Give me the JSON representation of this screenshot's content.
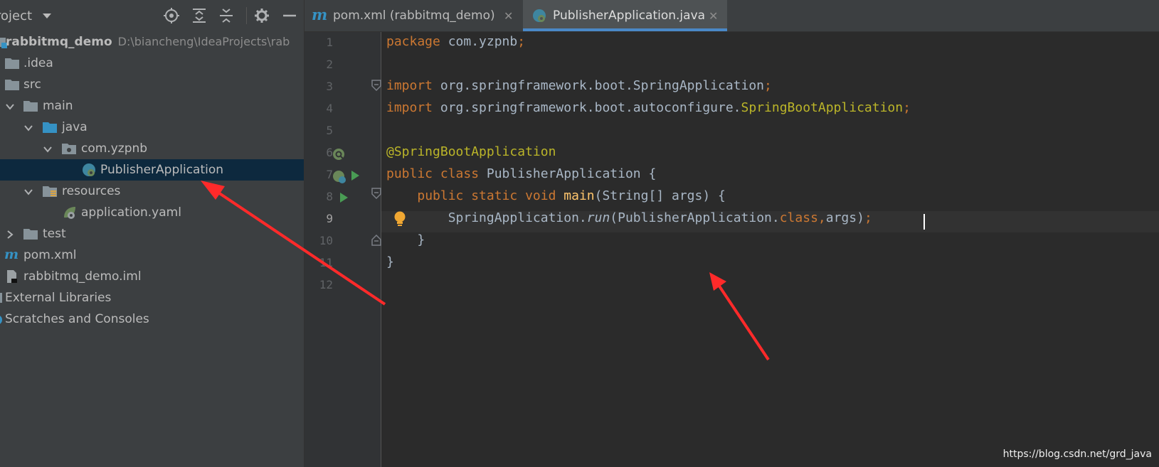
{
  "project_panel": {
    "title": "roject",
    "tree": [
      {
        "label": "rabbitmq_demo",
        "path": "D:\\biancheng\\IdeaProjects\\rab"
      },
      {
        "label": ".idea"
      },
      {
        "label": "src"
      },
      {
        "label": "main"
      },
      {
        "label": "java"
      },
      {
        "label": "com.yzpnb"
      },
      {
        "label": "PublisherApplication"
      },
      {
        "label": "resources"
      },
      {
        "label": "application.yaml"
      },
      {
        "label": "test"
      },
      {
        "label": "pom.xml"
      },
      {
        "label": "rabbitmq_demo.iml"
      },
      {
        "label": "External Libraries"
      },
      {
        "label": "Scratches and Consoles"
      }
    ],
    "icons": {
      "header": [
        "locate-icon",
        "expand-all-icon",
        "collapse-all-icon",
        "gear-icon",
        "minimize-icon"
      ],
      "tree": [
        "module-folder-icon",
        "folder-icon",
        "spring-boot-class-icon",
        "maven-icon",
        "spring-config-icon",
        "resources-folder-icon"
      ]
    }
  },
  "editor": {
    "tabs": [
      {
        "label": "pom.xml (rabbitmq_demo)",
        "close": "✕"
      },
      {
        "label": "PublisherApplication.java",
        "close": "✕"
      }
    ],
    "line_numbers": [
      "1",
      "2",
      "3",
      "4",
      "5",
      "6",
      "7",
      "8",
      "9",
      "10",
      "11",
      "12"
    ],
    "code": {
      "l1_kw": "package",
      "l1_rest": " com.yzpnb",
      "l1_semi": ";",
      "l3_kw": "import",
      "l3_rest": " org.springframework.boot.SpringApplication",
      "l3_semi": ";",
      "l4_kw": "import",
      "l4_rest": " org.springframework.boot.autoconfigure.",
      "l4_cls": "SpringBootApplication",
      "l4_semi": ";",
      "l6_ann": "@SpringBootApplication",
      "l7_kw": "public class",
      "l7_rest": " PublisherApplication {",
      "l8_indent": "    ",
      "l8_kw": "public static void",
      "l8_fn": " main",
      "l8_rest": "(String[] args) {",
      "l9_indent": "        ",
      "l9_a": "SpringApplication.",
      "l9_run": "run",
      "l9_b": "(PublisherApplication.",
      "l9_kw": "class,",
      "l9_c": "args)",
      "l9_semi": ";",
      "l10": "    }",
      "l11": "}"
    }
  },
  "watermark": "https://blog.csdn.net/grd_java",
  "colors": {
    "panel_bg": "#3c3f41",
    "editor_bg": "#2b2b2b",
    "selection": "#0d293e",
    "keyword": "#cc7832",
    "annotation": "#bbb529",
    "function": "#ffc66d",
    "arrow": "#ff2a2a",
    "tab_accent": "#4a88c7"
  }
}
